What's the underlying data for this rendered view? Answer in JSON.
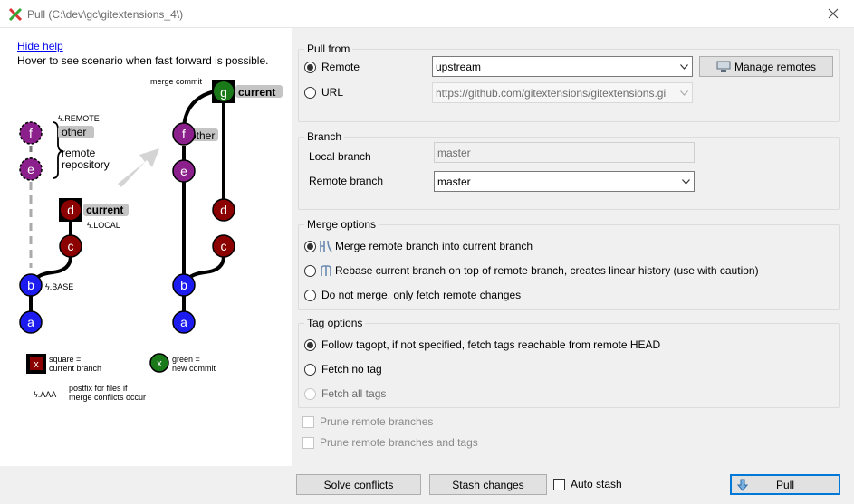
{
  "window": {
    "title": "Pull (C:\\dev\\gc\\gitextensions_4\\)"
  },
  "help": {
    "hide_help": "Hide help",
    "hint": "Hover to see scenario when fast forward is possible.",
    "merge_commit": "merge commit",
    "remote_tag": "ϟ.REMOTE",
    "other_label": "other",
    "other_label_right": "other",
    "remote_repo_line1": "remote",
    "remote_repo_line2": "repository",
    "current_left": "current",
    "current_right": "current",
    "local_tag": "ϟ.LOCAL",
    "base_tag": "ϟ.BASE",
    "nodes": {
      "a": "a",
      "b": "b",
      "c": "c",
      "d": "d",
      "e": "e",
      "f": "f",
      "g": "g",
      "x": "x"
    },
    "legend_square_line1": "square =",
    "legend_square_line2": "current branch",
    "legend_green_line1": "green =",
    "legend_green_line2": "new commit",
    "legend_aaa": "ϟ.AAA",
    "legend_postfix_line1": "postfix for files if",
    "legend_postfix_line2": "merge conflicts occur"
  },
  "pull_from": {
    "title": "Pull from",
    "remote_label": "Remote",
    "remote_value": "upstream",
    "manage_remotes": "Manage remotes",
    "url_label": "URL",
    "url_value": "https://github.com/gitextensions/gitextensions.gi"
  },
  "branch": {
    "title": "Branch",
    "local_label": "Local branch",
    "local_value": "master",
    "remote_label": "Remote branch",
    "remote_value": "master"
  },
  "merge_options": {
    "title": "Merge options",
    "merge": "Merge remote branch into current branch",
    "rebase": "Rebase current branch on top of remote branch, creates linear history (use with caution)",
    "fetch_only": "Do not merge, only fetch remote changes"
  },
  "tag_options": {
    "title": "Tag options",
    "follow": "Follow tagopt, if not specified, fetch tags reachable from remote HEAD",
    "no_tag": "Fetch no tag",
    "all_tags": "Fetch all tags"
  },
  "prune": {
    "branches": "Prune remote branches",
    "branches_tags": "Prune remote branches and tags"
  },
  "bottom": {
    "solve_conflicts": "Solve conflicts",
    "stash_changes": "Stash changes",
    "auto_stash": "Auto stash",
    "pull": "Pull"
  },
  "colors": {
    "purple": "#8b1f8b",
    "blue": "#1c1cf0",
    "red": "#8b0000",
    "green": "#1a7a1a",
    "accent": "#0078d7"
  }
}
